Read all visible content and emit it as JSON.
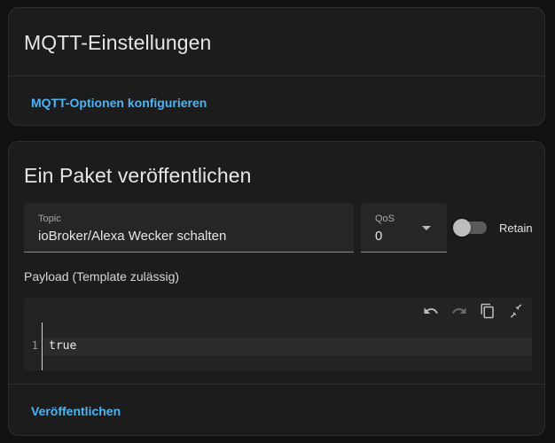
{
  "mqtt_settings": {
    "title": "MQTT-Einstellungen",
    "configure_link": "MQTT-Optionen konfigurieren"
  },
  "publish": {
    "title": "Ein Paket veröffentlichen",
    "topic": {
      "label": "Topic",
      "value": "ioBroker/Alexa Wecker schalten"
    },
    "qos": {
      "label": "QoS",
      "value": "0"
    },
    "retain": {
      "label": "Retain",
      "checked": false
    },
    "payload_label": "Payload (Template zulässig)",
    "editor": {
      "line_number": "1",
      "code": "true",
      "toolbar_icons": [
        "undo-icon",
        "redo-icon",
        "copy-icon",
        "fullscreen-icon"
      ]
    },
    "publish_button": "Veröffentlichen"
  },
  "colors": {
    "accent": "#4cb5f5",
    "card_bg": "#1c1c1c",
    "page_bg": "#111111"
  }
}
